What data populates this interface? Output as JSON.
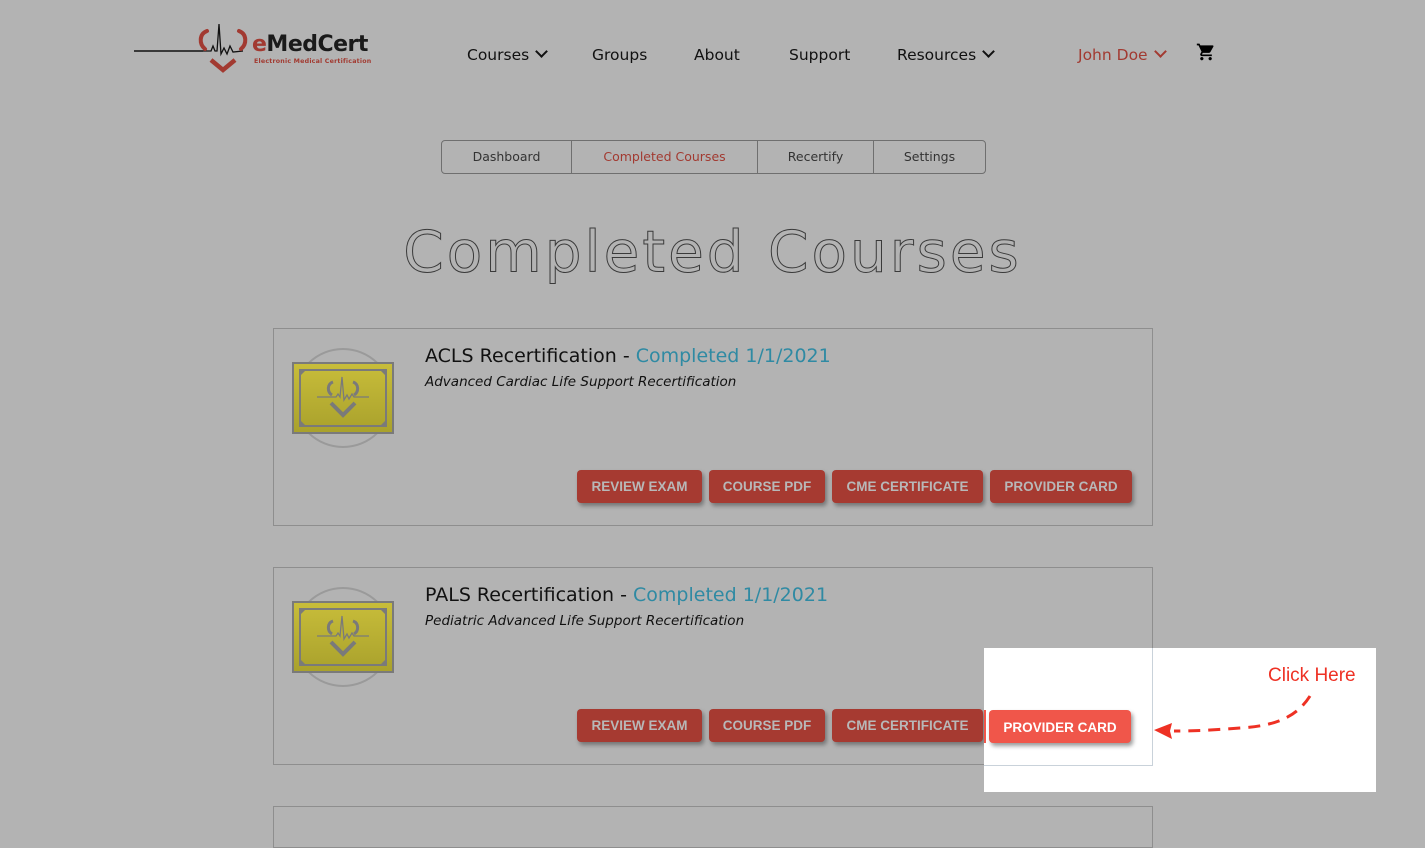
{
  "header": {
    "logo": {
      "brand_prefix": "e",
      "brand_rest": "MedCert",
      "tagline": "Electronic  Medical  Certification"
    },
    "nav": [
      {
        "label": "Courses",
        "has_dropdown": true
      },
      {
        "label": "Groups",
        "has_dropdown": false
      },
      {
        "label": "About",
        "has_dropdown": false
      },
      {
        "label": "Support",
        "has_dropdown": false
      },
      {
        "label": "Resources",
        "has_dropdown": true
      }
    ],
    "user": {
      "label": "John Doe",
      "has_dropdown": true
    },
    "cart_icon": "shopping-cart-icon"
  },
  "tabs": [
    {
      "label": "Dashboard",
      "active": false
    },
    {
      "label": "Completed Courses",
      "active": true
    },
    {
      "label": "Recertify",
      "active": false
    },
    {
      "label": "Settings",
      "active": false
    }
  ],
  "page_title": "Completed Courses",
  "courses": [
    {
      "title": "ACLS Recertification",
      "separator": " - ",
      "status": "Completed 1/1/2021",
      "subtitle": "Advanced Cardiac Life Support Recertification",
      "icon": "certificate-icon",
      "buttons": [
        "REVIEW EXAM",
        "COURSE PDF",
        "CME CERTIFICATE",
        "PROVIDER CARD"
      ]
    },
    {
      "title": "PALS Recertification",
      "separator": " - ",
      "status": "Completed 1/1/2021",
      "subtitle": "Pediatric Advanced Life Support Recertification",
      "icon": "certificate-icon",
      "buttons": [
        "REVIEW EXAM",
        "COURSE PDF",
        "CME CERTIFICATE",
        "PROVIDER CARD"
      ]
    }
  ],
  "annotation": {
    "text": "Click Here",
    "highlighted_button": "PROVIDER CARD"
  },
  "colors": {
    "overlay_bg": "#b3b3b3",
    "brand_red": "#a23a31",
    "status_teal": "#2f8aa3",
    "button_dimmed": "#a63a31",
    "button_highlight": "#f0564a",
    "annotation_red": "#ee3124"
  }
}
